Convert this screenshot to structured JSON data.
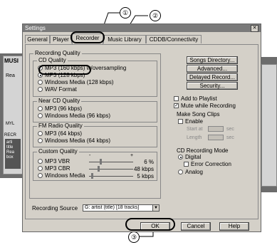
{
  "callouts": [
    "①",
    "②",
    "③"
  ],
  "dialog": {
    "title": "Settings",
    "tabs": [
      "General",
      "Player",
      "Recorder",
      "Music Library",
      "CDDB/Connectivity"
    ],
    "active_tab": "Recorder"
  },
  "recording_quality": {
    "title": "Recording Quality",
    "cd_quality": {
      "title": "CD Quality",
      "options": [
        "MP3 (160 kbps) w/oversampling",
        "MP3 (128 kbps)",
        "Windows Media (128 kbps)",
        "WAV Format"
      ],
      "selected": 1
    },
    "near_cd_quality": {
      "title": "Near CD Quality",
      "options": [
        "MP3 (96 kbps)",
        "Windows Media (96 kbps)"
      ]
    },
    "fm_radio_quality": {
      "title": "FM Radio Quality",
      "options": [
        "MP3 (64 kbps)",
        "Windows Media (64 kbps)"
      ]
    },
    "custom_quality": {
      "title": "Custom Quality",
      "scale_minus": "-",
      "scale_plus": "+",
      "rows": [
        {
          "label": "MP3 VBR",
          "value": "6 %",
          "level": 0.25
        },
        {
          "label": "MP3 CBR",
          "value": "48 kbps",
          "level": 0.2
        },
        {
          "label": "Windows Media",
          "value": "5 kbps",
          "level": 0.05
        }
      ]
    }
  },
  "recording_source": {
    "label": "Recording Source",
    "value": "G: artist (title) [18 tracks]"
  },
  "side_buttons": {
    "songs_directory": "Songs Directory...",
    "advanced": "Advanced...",
    "delayed_record": "Delayed Record...",
    "security": "Security..."
  },
  "checkboxes": {
    "add_to_playlist": {
      "label": "Add to Playlist",
      "checked": false
    },
    "mute_while_recording": {
      "label": "Mute while Recording",
      "checked": true
    }
  },
  "make_song_clips": {
    "title": "Make Song Clips",
    "enable": "Enable",
    "start_at": "Start at",
    "length": "Length",
    "unit": "sec"
  },
  "cd_recording_mode": {
    "title": "CD Recording Mode",
    "digital": "Digital",
    "error_correction": "Error Correction",
    "analog": "Analog"
  },
  "footer": {
    "ok": "OK",
    "cancel": "Cancel",
    "help": "Help"
  },
  "background": {
    "music_label": "MUSI",
    "rec_label": "Rea",
    "mv_label": "MYL",
    "recd_label": "RECR",
    "list_lines": [
      "arti",
      "title",
      "Rea",
      "box"
    ]
  }
}
